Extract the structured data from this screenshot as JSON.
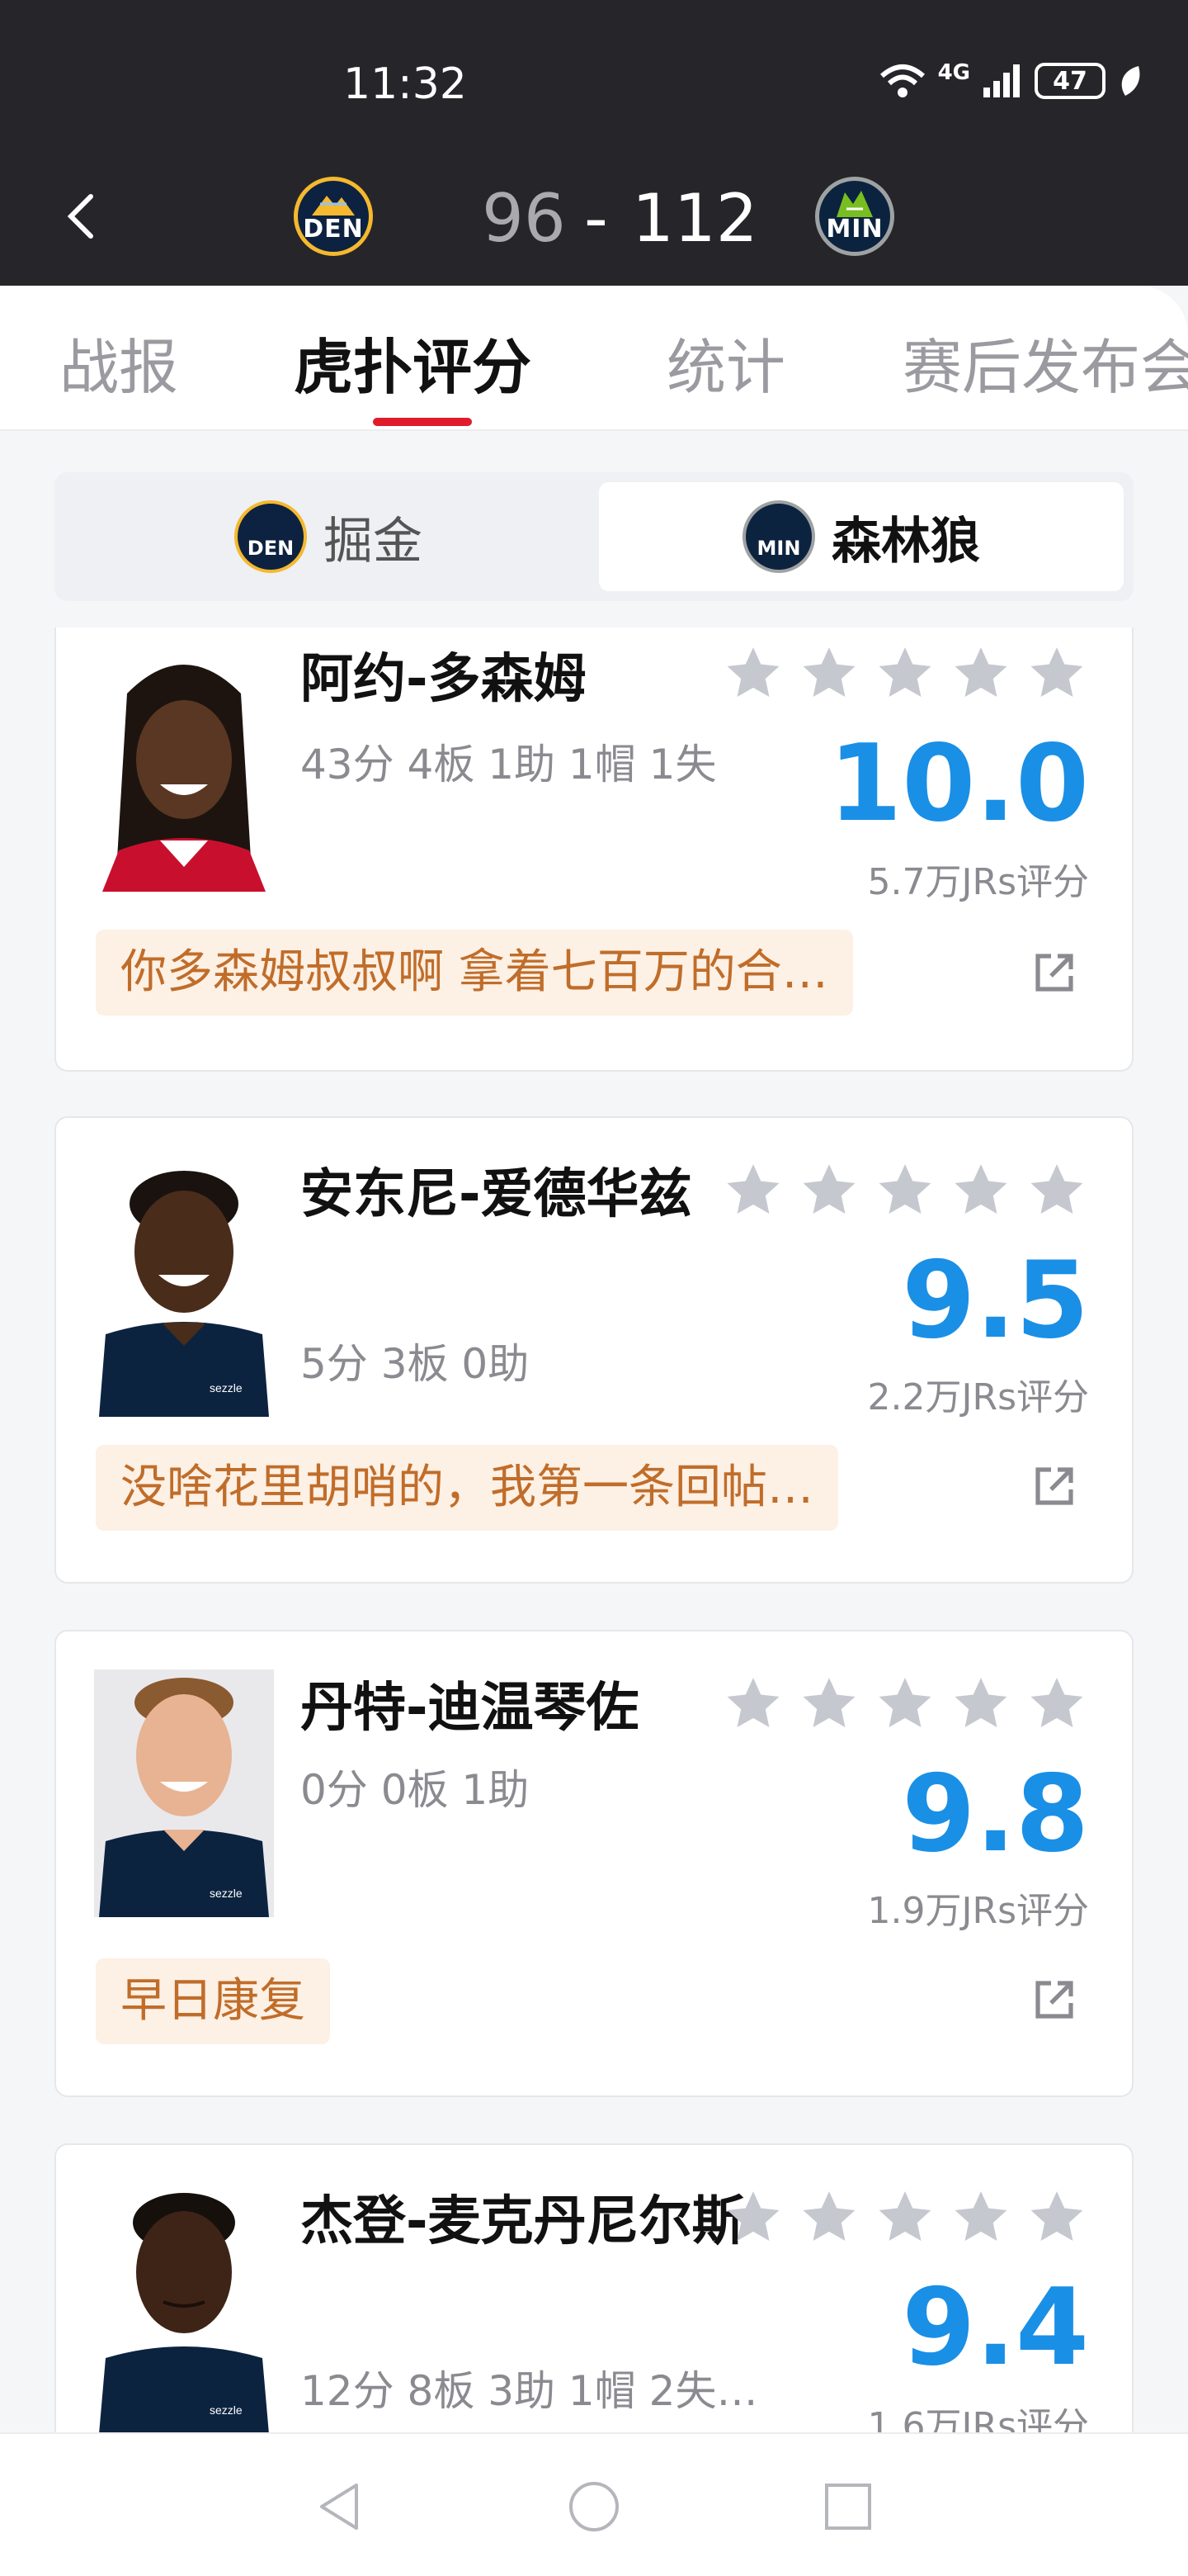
{
  "status_bar": {
    "time": "11:32",
    "network": "4G",
    "battery": "47"
  },
  "header": {
    "away_team_abbr": "DEN",
    "home_team_abbr": "MIN",
    "away_score": "96",
    "separator": "-",
    "home_score": "112"
  },
  "tabs": [
    {
      "label": "战报",
      "active": false
    },
    {
      "label": "虎扑评分",
      "active": true
    },
    {
      "label": "统计",
      "active": false
    },
    {
      "label": "赛后发布会",
      "active": false
    }
  ],
  "team_switch": {
    "away": {
      "label": "掘金",
      "abbr": "DEN"
    },
    "home": {
      "label": "森林狼",
      "abbr": "MIN",
      "selected": true
    }
  },
  "players": [
    {
      "name": "阿约-多森姆",
      "stats": "43分 4板 1助 1帽 1失",
      "rating": "10.0",
      "votes": "5.7万JRs评分",
      "comment": "你多森姆叔叔啊 拿着七百万的合…"
    },
    {
      "name": "安东尼-爱德华兹",
      "stats": "5分 3板 0助",
      "rating": "9.5",
      "votes": "2.2万JRs评分",
      "comment": "没啥花里胡哨的，我第一条回帖…"
    },
    {
      "name": "丹特-迪温琴佐",
      "stats": "0分 0板 1助",
      "rating": "9.8",
      "votes": "1.9万JRs评分",
      "comment": "早日康复"
    },
    {
      "name": "杰登-麦克丹尼尔斯",
      "stats": "12分 8板 3助 1帽 2失…",
      "rating": "9.4",
      "votes": "1.6万JRs评分",
      "comment": ""
    }
  ],
  "colors": {
    "accent_red": "#e01c2c",
    "rating_blue": "#1a8fe6",
    "comment_text": "#c06d2a",
    "comment_bg": "#fdf0e4"
  },
  "icons": {
    "back": "chevron-left-icon",
    "external": "external-link-icon",
    "star": "star-icon"
  }
}
